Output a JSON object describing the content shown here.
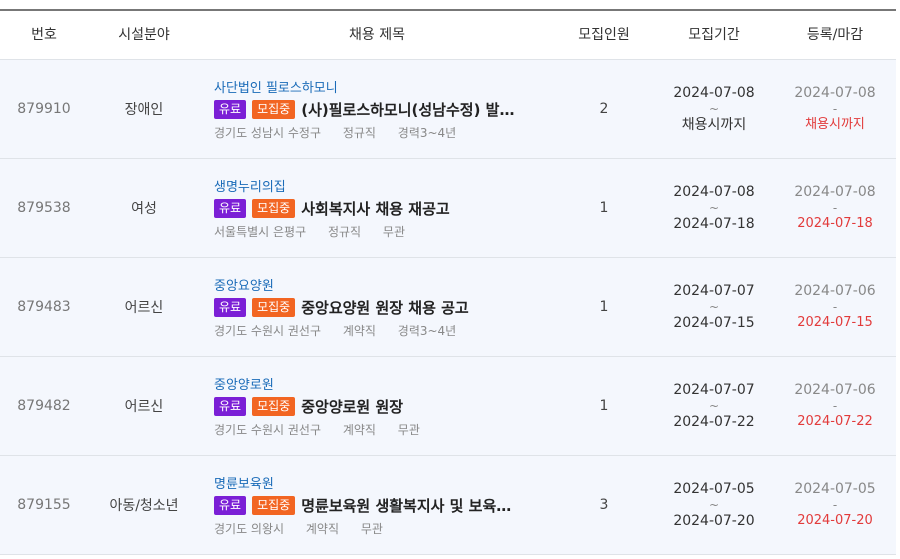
{
  "columns": {
    "number": "번호",
    "field": "시설분야",
    "title": "채용 제목",
    "count": "모집인원",
    "period": "모집기간",
    "register": "등록/마감"
  },
  "rows": [
    {
      "number": "879910",
      "field": "장애인",
      "org": "사단법인 필로스하모니",
      "badge_paid": "유료",
      "badge_status": "모집중",
      "title": "(사)필로스하모니(성남수정) 발달장애인 주간활동서비스 제공인력 채용",
      "region": "경기도 성남시 수정구",
      "employment": "정규직",
      "career": "경력3~4년",
      "count": "2",
      "period_start": "2024-07-08",
      "period_sep": "~",
      "period_end": "채용시까지",
      "reg_date": "2024-07-08",
      "reg_sep": "-",
      "deadline": "채용시까지"
    },
    {
      "number": "879538",
      "field": "여성",
      "org": "생명누리의집",
      "badge_paid": "유료",
      "badge_status": "모집중",
      "title": "사회복지사 채용 재공고",
      "region": "서울특별시 은평구",
      "employment": "정규직",
      "career": "무관",
      "count": "1",
      "period_start": "2024-07-08",
      "period_sep": "~",
      "period_end": "2024-07-18",
      "reg_date": "2024-07-08",
      "reg_sep": "-",
      "deadline": "2024-07-18"
    },
    {
      "number": "879483",
      "field": "어르신",
      "org": "중앙요양원",
      "badge_paid": "유료",
      "badge_status": "모집중",
      "title": "중앙요양원 원장 채용 공고",
      "region": "경기도 수원시 권선구",
      "employment": "계약직",
      "career": "경력3~4년",
      "count": "1",
      "period_start": "2024-07-07",
      "period_sep": "~",
      "period_end": "2024-07-15",
      "reg_date": "2024-07-06",
      "reg_sep": "-",
      "deadline": "2024-07-15"
    },
    {
      "number": "879482",
      "field": "어르신",
      "org": "중앙양로원",
      "badge_paid": "유료",
      "badge_status": "모집중",
      "title": "중앙양로원 원장",
      "region": "경기도 수원시 권선구",
      "employment": "계약직",
      "career": "무관",
      "count": "1",
      "period_start": "2024-07-07",
      "period_sep": "~",
      "period_end": "2024-07-22",
      "reg_date": "2024-07-06",
      "reg_sep": "-",
      "deadline": "2024-07-22"
    },
    {
      "number": "879155",
      "field": "아동/청소년",
      "org": "명륜보육원",
      "badge_paid": "유료",
      "badge_status": "모집중",
      "title": "명륜보육원 생활복지사 및 보육사 채용",
      "region": "경기도 의왕시",
      "employment": "계약직",
      "career": "무관",
      "count": "3",
      "period_start": "2024-07-05",
      "period_sep": "~",
      "period_end": "2024-07-20",
      "reg_date": "2024-07-05",
      "reg_sep": "-",
      "deadline": "2024-07-20"
    }
  ],
  "colors": {
    "row_bg": "#f4f7fd",
    "org_link": "#1a6bb8",
    "badge_paid": "#7b1fd6",
    "badge_status": "#f26522",
    "deadline": "#e23b3b"
  }
}
